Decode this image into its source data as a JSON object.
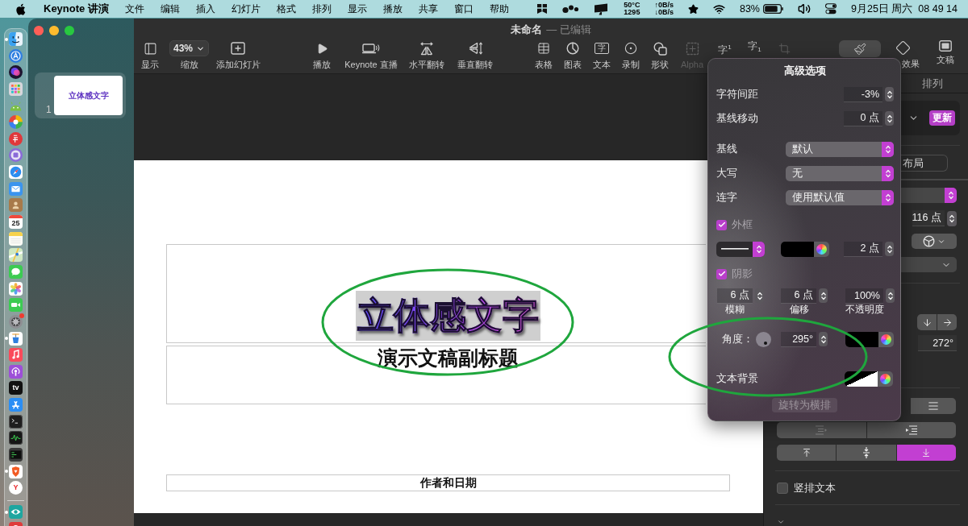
{
  "menu_bar": {
    "app_name": "Keynote 讲演",
    "menus": [
      "文件",
      "编辑",
      "插入",
      "幻灯片",
      "格式",
      "排列",
      "显示",
      "播放",
      "共享",
      "窗口",
      "帮助"
    ],
    "status": {
      "temperature": "50°C",
      "fan_speed": "1295",
      "upload": "↑0B/s",
      "download": "↓0B/s",
      "battery": "83%",
      "date": "9月25日 周六",
      "time": "08 49 14"
    }
  },
  "dock": {
    "apps": [
      {
        "kind": "finder",
        "running": true,
        "badge": false
      },
      {
        "kind": "ring",
        "running": false,
        "badge": false
      },
      {
        "kind": "orb",
        "running": false,
        "badge": false
      },
      {
        "kind": "grid",
        "running": false,
        "badge": false
      },
      {
        "kind": "robot",
        "running": false,
        "badge": false
      },
      {
        "kind": "pinwheel",
        "running": false,
        "badge": false
      },
      {
        "kind": "seal",
        "running": false,
        "badge": false
      },
      {
        "kind": "disc",
        "running": false,
        "badge": false
      },
      {
        "kind": "compass",
        "running": false,
        "badge": false
      },
      {
        "kind": "envelope",
        "running": false,
        "badge": false
      },
      {
        "kind": "book",
        "running": false,
        "badge": false
      },
      {
        "kind": "calendar",
        "text": "25",
        "running": false,
        "badge": false
      },
      {
        "kind": "notepad",
        "running": false,
        "badge": false
      },
      {
        "kind": "map",
        "running": false,
        "badge": false
      },
      {
        "kind": "bubble",
        "running": false,
        "badge": false
      },
      {
        "kind": "flower",
        "running": false,
        "badge": false
      },
      {
        "kind": "camera",
        "running": false,
        "badge": false
      },
      {
        "kind": "gear",
        "running": false,
        "badge": true
      },
      {
        "kind": "podium",
        "running": true,
        "badge": false
      },
      {
        "kind": "note",
        "running": false,
        "badge": false
      },
      {
        "kind": "podcast",
        "running": false,
        "badge": false
      },
      {
        "kind": "tv",
        "text": "tv",
        "running": false,
        "badge": false
      },
      {
        "kind": "store",
        "running": false,
        "badge": false
      },
      {
        "kind": "terminal",
        "running": false,
        "badge": false
      },
      {
        "kind": "activity",
        "running": false,
        "badge": false
      },
      {
        "kind": "console",
        "running": false,
        "badge": false
      },
      {
        "kind": "shield",
        "running": true,
        "badge": false
      },
      {
        "kind": "letter",
        "text": "Y",
        "running": false,
        "badge": false
      }
    ],
    "recent": [
      {
        "kind": "eye",
        "running": true,
        "badge": false
      },
      {
        "kind": "partial",
        "running": false,
        "badge": false
      }
    ]
  },
  "window": {
    "title": "未命名",
    "edited": "— 已编辑"
  },
  "toolbar": {
    "groups": [
      {
        "items": [
          {
            "kind": "sidebar",
            "label": "显示",
            "disabled": false
          },
          {
            "kind": "zoom",
            "label": "缩放",
            "value": "43%",
            "disabled": false
          },
          {
            "kind": "add-slide",
            "label": "添加幻灯片",
            "disabled": false
          }
        ]
      },
      {
        "items": [
          {
            "kind": "play",
            "label": "播放",
            "disabled": false
          },
          {
            "kind": "live",
            "label": "Keynote 直播",
            "disabled": false
          },
          {
            "kind": "flip-h",
            "label": "水平翻转",
            "disabled": false
          },
          {
            "kind": "flip-v",
            "label": "垂直翻转",
            "disabled": false
          }
        ]
      },
      {
        "items": [
          {
            "kind": "table",
            "label": "表格",
            "disabled": false
          },
          {
            "kind": "chart",
            "label": "图表",
            "disabled": false
          },
          {
            "kind": "text",
            "label": "文本",
            "glyph": "字",
            "disabled": false
          },
          {
            "kind": "record",
            "label": "录制",
            "disabled": false
          },
          {
            "kind": "shape",
            "label": "形状",
            "disabled": false
          },
          {
            "kind": "alpha",
            "label": "Alpha",
            "disabled": true
          },
          {
            "kind": "superscript",
            "glyph": "字$^{1}$",
            "disabled": false
          },
          {
            "kind": "subscript",
            "glyph": "字$_{1}$",
            "disabled": false
          },
          {
            "kind": "crop",
            "disabled": true
          }
        ]
      },
      {
        "items": [
          {
            "kind": "format",
            "selected": true
          },
          {
            "kind": "animate",
            "label": "效果",
            "selected": false
          },
          {
            "kind": "document",
            "label": "文稿",
            "selected": false
          }
        ]
      }
    ]
  },
  "sidebar": {
    "slides": [
      {
        "number": "1",
        "title": "立体感文字",
        "selected": true
      }
    ]
  },
  "slide": {
    "title": {
      "text": "立体感文字",
      "selected": true
    },
    "subtitle": "演示文稿副标题",
    "footer": "作者和日期"
  },
  "inspector": {
    "tabs": [
      {
        "label": "排列",
        "selected": false
      }
    ],
    "update_button": "更新",
    "layout_button": "布局",
    "font_size": "116 点",
    "rotation": "272°",
    "horizontal_alignment": [
      {
        "kind": "justify",
        "selected": false
      }
    ],
    "indent": [
      {
        "kind": "outdent",
        "disabled": true
      },
      {
        "kind": "indent",
        "disabled": false
      }
    ],
    "vertical_alignment": [
      {
        "kind": "top",
        "selected": false
      },
      {
        "kind": "middle",
        "selected": false
      },
      {
        "kind": "bottom",
        "selected": true
      }
    ],
    "vertical_text": {
      "label": "竖排文本",
      "checked": false
    }
  },
  "advanced_options": {
    "title": "高级选项",
    "rows": [
      {
        "kind": "field",
        "label": "字符间距",
        "value": "-3%"
      },
      {
        "kind": "field",
        "label": "基线移动",
        "value": "0 点"
      },
      {
        "kind": "popup",
        "label": "基线",
        "value": "默认"
      },
      {
        "kind": "popup",
        "label": "大写",
        "value": "无"
      },
      {
        "kind": "popup",
        "label": "连字",
        "value": "使用默认值"
      }
    ],
    "outline": {
      "label": "外框",
      "checked": true,
      "color": "#000000",
      "width": "2 点"
    },
    "shadow": {
      "label": "阴影",
      "checked": true,
      "fields": [
        {
          "value": "6 点",
          "label": "模糊"
        },
        {
          "value": "6 点",
          "label": "偏移"
        },
        {
          "value": "100%",
          "label": "不透明度"
        }
      ],
      "angle_label": "角度：",
      "angle": "295°",
      "color": "#000000"
    },
    "text_background": {
      "label": "文本背景"
    },
    "rotate_button": {
      "label": "旋转为横排",
      "disabled": true
    }
  },
  "annotations": [
    {
      "kind": "ellipse"
    },
    {
      "kind": "ellipse"
    }
  ]
}
